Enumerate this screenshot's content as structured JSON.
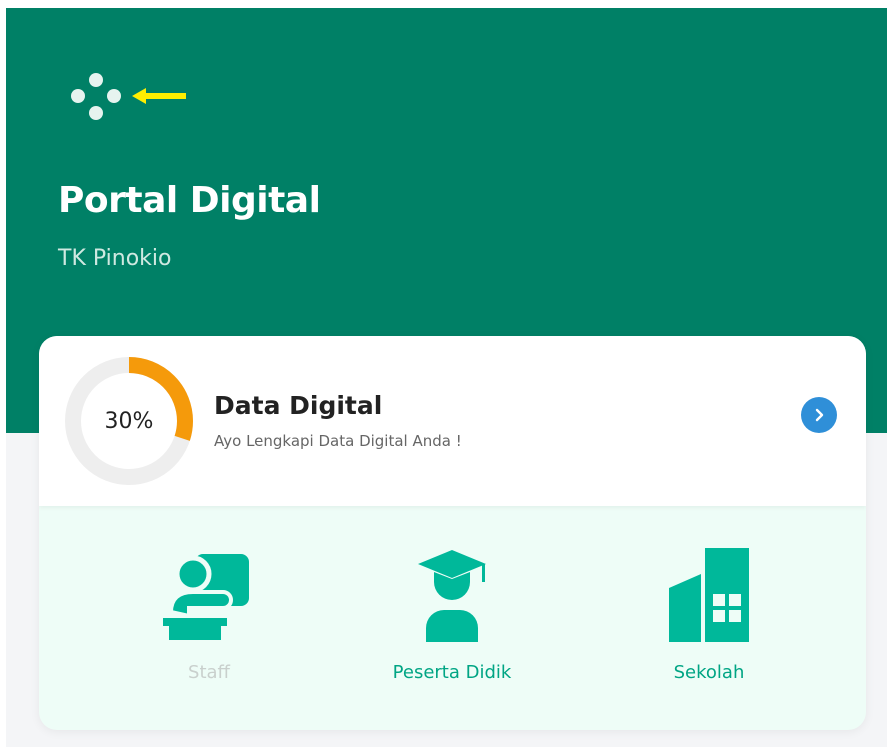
{
  "header": {
    "menu_icon": "dots-menu-icon",
    "arrow_icon": "left-arrow-icon",
    "title": "Portal Digital",
    "subtitle": "TK Pinokio"
  },
  "progress_card": {
    "percent_label": "30%",
    "progress": 0.3,
    "title": "Data Digital",
    "subtitle": "Ayo Lengkapi Data Digital Anda !",
    "action_icon": "chevron-right-icon"
  },
  "features": [
    {
      "label": "Staff",
      "icon": "teacher-icon",
      "enabled": false
    },
    {
      "label": "Peserta Didik",
      "icon": "student-graduate-icon",
      "enabled": true
    },
    {
      "label": "Sekolah",
      "icon": "school-building-icon",
      "enabled": true
    }
  ],
  "colors": {
    "brand_green": "#008066",
    "accent_teal": "#00b89a",
    "progress_orange": "#f59a0b",
    "action_blue": "#2f8fd8",
    "arrow_yellow": "#ffee00"
  }
}
